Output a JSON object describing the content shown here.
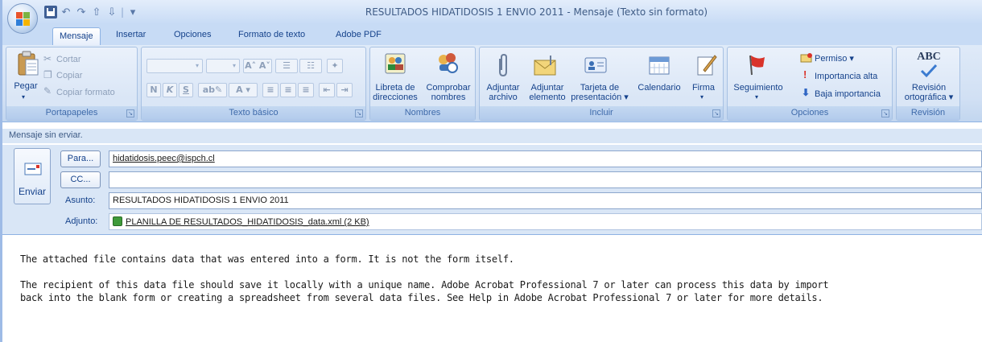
{
  "window": {
    "title": "RESULTADOS HIDATIDOSIS 1 ENVIO 2011 - Mensaje (Texto sin formato)"
  },
  "ribbon_tabs": [
    "Mensaje",
    "Insertar",
    "Opciones",
    "Formato de texto",
    "Adobe PDF"
  ],
  "groups": {
    "clipboard": {
      "label": "Portapapeles",
      "paste": "Pegar",
      "cut": "Cortar",
      "copy": "Copiar",
      "format_painter": "Copiar formato"
    },
    "basic_text": {
      "label": "Texto básico",
      "bold": "N",
      "italic": "K",
      "underline": "S"
    },
    "names": {
      "label": "Nombres",
      "address_book": [
        "Libreta de",
        "direcciones"
      ],
      "check_names": [
        "Comprobar",
        "nombres"
      ]
    },
    "include": {
      "label": "Incluir",
      "attach_file": [
        "Adjuntar",
        "archivo"
      ],
      "attach_item": [
        "Adjuntar",
        "elemento"
      ],
      "business_card": [
        "Tarjeta de",
        "presentación ▾"
      ],
      "calendar": "Calendario",
      "signature": "Firma"
    },
    "options": {
      "label": "Opciones",
      "follow_up": "Seguimiento",
      "permission": "Permiso ▾",
      "high_importance": "Importancia alta",
      "low_importance": "Baja importancia"
    },
    "proofing": {
      "label": "Revisión",
      "spelling": [
        "Revisión",
        "ortográfica ▾"
      ],
      "abc": "ABC"
    }
  },
  "info_bar": "Mensaje sin erviar.",
  "send_button": "Enviar",
  "to_button": "Para...",
  "cc_button": "CC...",
  "to_value": "hidatidosis.peec@ispch.cl",
  "cc_value": "",
  "subject_label": "Asunto:",
  "subject_value": "RESULTADOS HIDATIDOSIS 1 ENVIO 2011",
  "attachment_label": "Adjunto:",
  "attachment_value": "PLANILLA DE RESULTADOS_HIDATIDOSIS_data.xml (2 KB)",
  "body": {
    "line1": "The attached file contains data that was entered into a form. It is not the form itself.",
    "line2": "The recipient of this data file should save it locally with a unique name. Adobe Acrobat Professional 7 or later can process this data by import",
    "line3": "back into the blank form or creating a spreadsheet from several data files. See Help in Adobe Acrobat Professional 7 or later for more details."
  },
  "colors": {
    "ribbon": "#d1e0f4",
    "accent": "#15428b",
    "frame": "#9ebbe6"
  }
}
